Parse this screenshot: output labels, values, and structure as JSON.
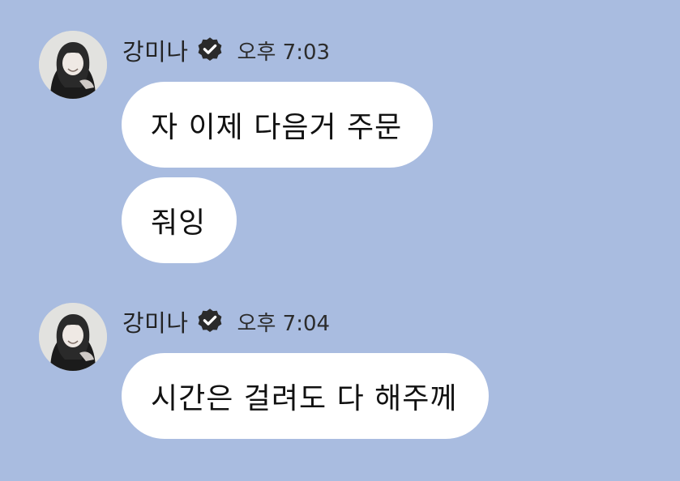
{
  "colors": {
    "background": "#a9bce0",
    "bubble": "#ffffff",
    "verified_badge": "#2a2a2a"
  },
  "groups": [
    {
      "sender": {
        "name": "강미나",
        "avatar_icon": "profile-photo",
        "badge_icon": "verified-check-icon"
      },
      "time": "오후 7:03",
      "messages": [
        {
          "text": "자 이제 다음거 주문"
        },
        {
          "text": "줘잉"
        }
      ]
    },
    {
      "sender": {
        "name": "강미나",
        "avatar_icon": "profile-photo",
        "badge_icon": "verified-check-icon"
      },
      "time": "오후 7:04",
      "messages": [
        {
          "text": "시간은 걸려도 다 해주께"
        }
      ]
    }
  ]
}
